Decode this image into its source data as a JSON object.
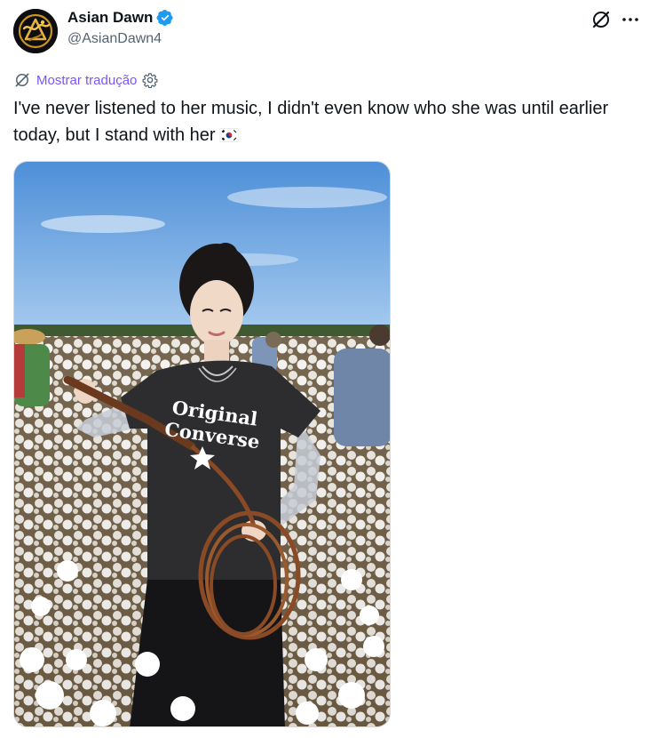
{
  "author": {
    "display_name": "Asian Dawn",
    "handle": "@AsianDawn4",
    "verified": true,
    "avatar_icon": "golden-dragon-logo"
  },
  "header_actions": {
    "grok_icon": "grok-icon",
    "more_icon": "more-horizontal-icon"
  },
  "translation": {
    "label": "Mostrar tradução",
    "icon": "grok-icon",
    "settings_icon": "gear-icon"
  },
  "tweet": {
    "text": "I've never listened to her music, I didn't even know who she was until earlier today, but I stand with her",
    "emoji": "south-korea-flag"
  },
  "media": {
    "shirt_text_line1": "Original",
    "shirt_text_line2": "Converse"
  },
  "colors": {
    "link": "#7856ff",
    "verified": "#1d9bf0",
    "secondary_text": "#536471"
  }
}
